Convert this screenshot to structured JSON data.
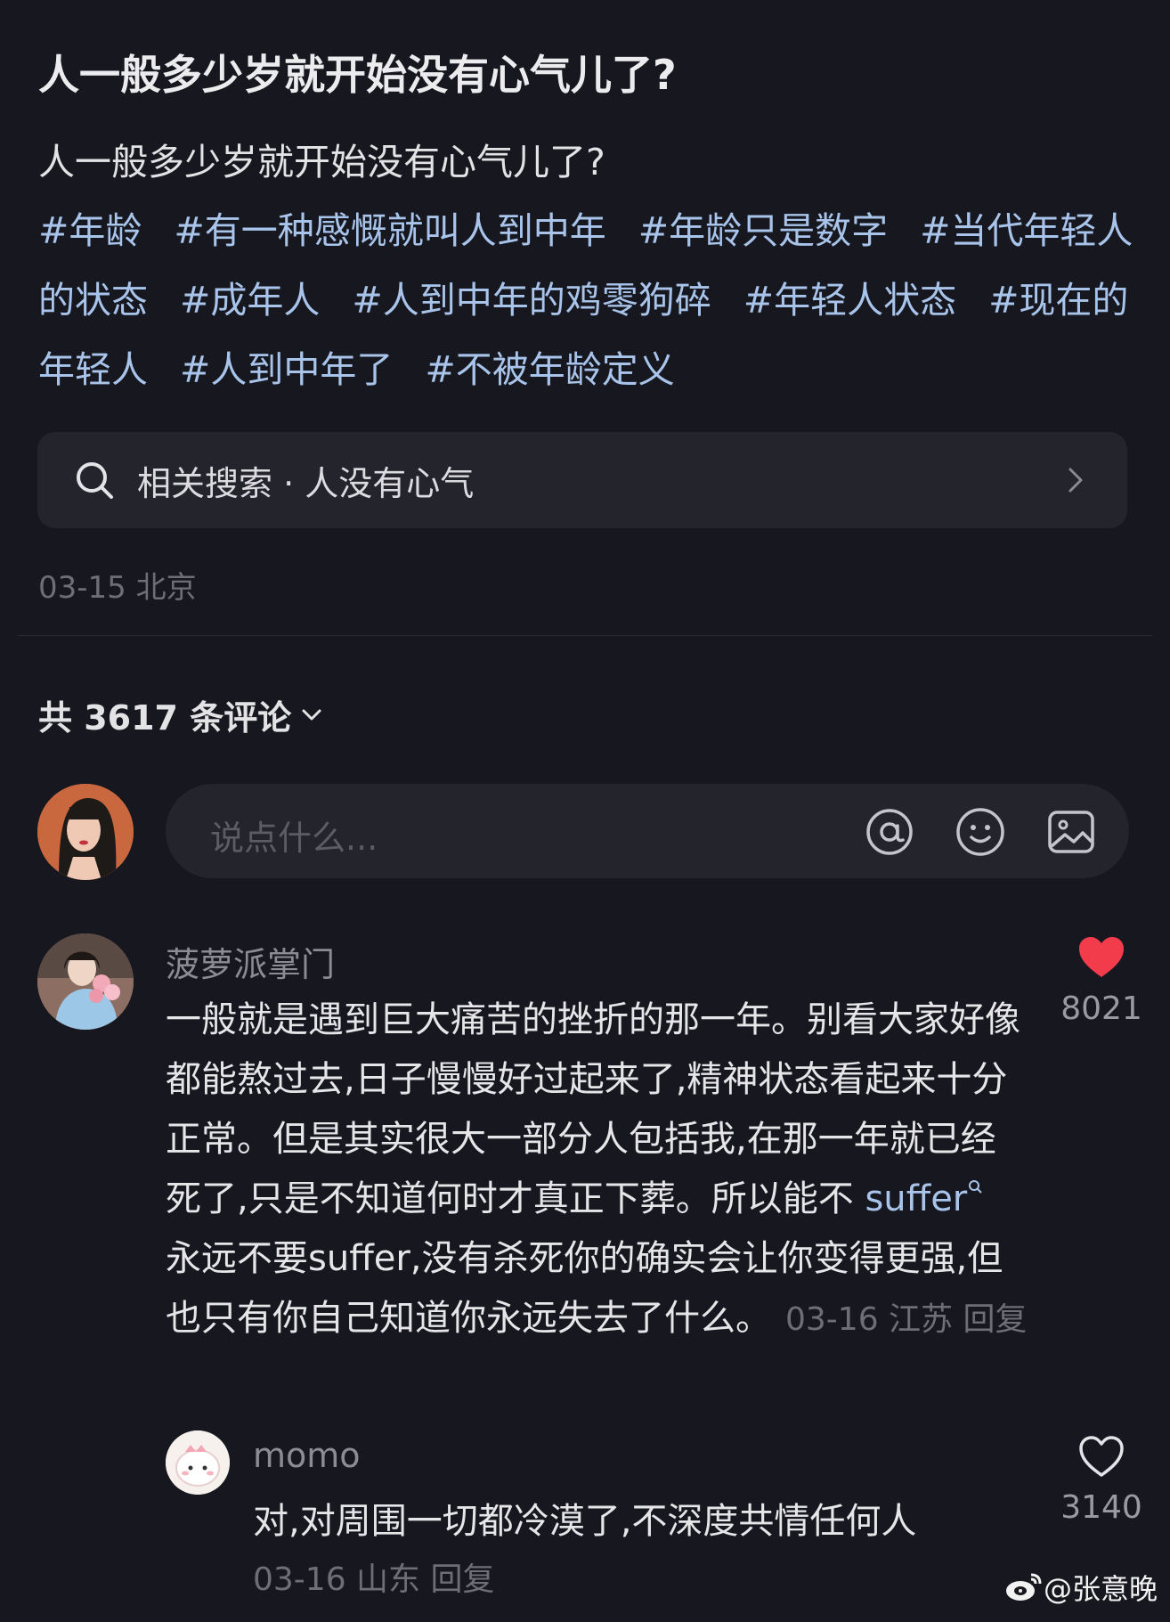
{
  "post": {
    "title": "人一般多少岁就开始没有心气儿了?",
    "body": "人一般多少岁就开始没有心气儿了?",
    "tags": [
      "#年龄",
      "#有一种感慨就叫人到中年",
      "#年龄只是数字",
      "#当代年轻人的状态",
      "#成年人",
      "#人到中年的鸡零狗碎",
      "#年轻人状态",
      "#现在的年轻人",
      "#人到中年了",
      "#不被年龄定义"
    ],
    "related_search": "相关搜索 · 人没有心气",
    "meta": "03-15 北京"
  },
  "comments_header": {
    "count_label": "共 3617 条评论"
  },
  "input": {
    "placeholder": "说点什么..."
  },
  "icons": {
    "search": "search-icon",
    "chevron": "chevron-right-icon",
    "at": "at-icon",
    "emoji": "emoji-icon",
    "image": "image-icon",
    "heart_filled": "heart-filled-icon",
    "heart_outline": "heart-outline-icon"
  },
  "comments": [
    {
      "user": "菠萝派掌门",
      "text_before": "一般就是遇到巨大痛苦的挫折的那一年。别看大家好像都能熬过去,日子慢慢好过起来了,精神状态看起来十分正常。但是其实很大一部分人包括我,在那一年就已经死了,只是不知道何时才真正下葬。所以能不 ",
      "link": "suffer",
      "text_after": " 永远不要suffer,没有杀死你的确实会让你变得更强,但也只有你自己知道你永远失去了什么。",
      "meta": "03-16 江苏 回复",
      "likes": "8021",
      "liked": true,
      "like_color": "#f23c4c"
    },
    {
      "user": "momo",
      "text": "对,对周围一切都冷漠了,不深度共情任何人",
      "meta": "03-16 山东 回复",
      "likes": "3140",
      "liked": false
    }
  ],
  "watermark": "@张意晚",
  "colors": {
    "background": "#17171f",
    "tag": "#a8c4ea",
    "surface": "#24242c"
  }
}
